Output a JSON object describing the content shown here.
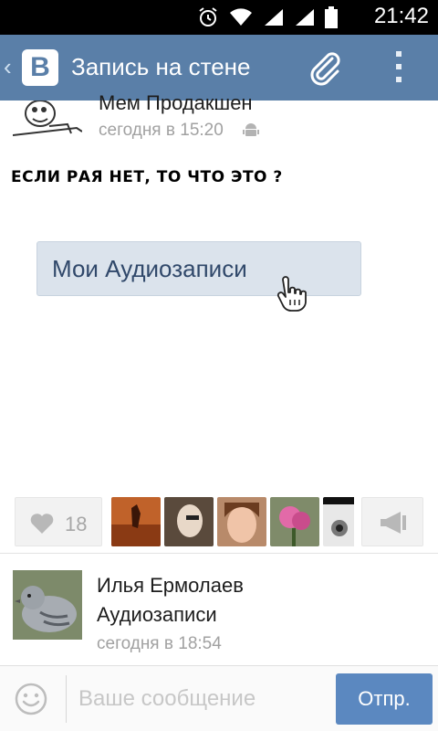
{
  "status_bar": {
    "time": "21:42",
    "icons": [
      "alarm-icon",
      "wifi-icon",
      "signal-icon",
      "signal-icon",
      "battery-icon"
    ]
  },
  "app_bar": {
    "logo_letter": "В",
    "title": "Запись на стене",
    "icons": [
      "back-chevron-icon",
      "paperclip-icon",
      "overflow-menu-icon"
    ]
  },
  "post": {
    "author": "Мем Продакшен",
    "time": "сегодня в 15:20",
    "platform_icon": "android-icon",
    "text": "ЕСЛИ РАЯ НЕТ, ТО ЧТО ЭТО ?",
    "button_label": "Мои Аудиозаписи"
  },
  "actions": {
    "like_count": "18",
    "likers": [
      "liker-1",
      "liker-2",
      "liker-3",
      "liker-4",
      "liker-5"
    ]
  },
  "comment": {
    "author": "Илья Ермолаев",
    "text": "Аудиозаписи",
    "time": "сегодня в 18:54"
  },
  "compose": {
    "placeholder": "Ваше сообщение",
    "send_label": "Отпр."
  },
  "colors": {
    "app_bar": "#5a7fa8",
    "send_button": "#5b88c0",
    "muted_text": "#a1a1a1"
  }
}
